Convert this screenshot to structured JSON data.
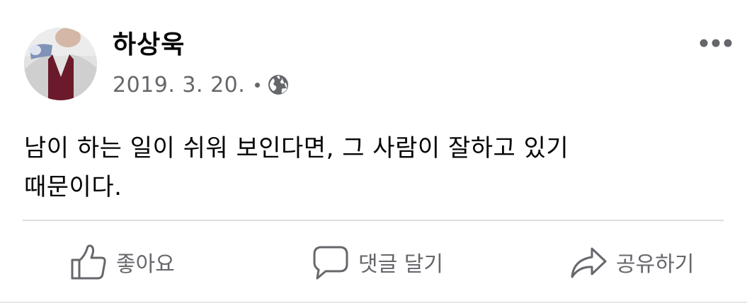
{
  "post": {
    "author": "하상욱",
    "date": "2019. 3. 20.",
    "privacy_icon": "globe-icon",
    "text": "남이 하는 일이 쉬워 보인다면, 그 사람이 잘하고 있기\n때문이다."
  },
  "actions": {
    "like_label": "좋아요",
    "comment_label": "댓글 달기",
    "share_label": "공유하기"
  },
  "icons": {
    "more": "more-horizontal-icon",
    "like": "thumbs-up-icon",
    "comment": "speech-bubble-icon",
    "share": "share-arrow-icon"
  },
  "colors": {
    "text_primary": "#050505",
    "text_secondary": "#65676b",
    "divider": "#dadde1"
  }
}
